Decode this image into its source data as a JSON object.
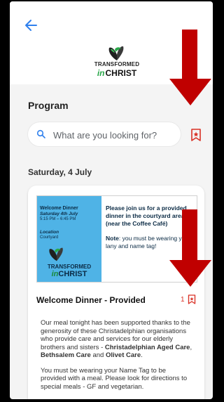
{
  "header": {
    "logo": {
      "line1": "TRANSFORMED",
      "line2_in": "in",
      "line2_rest": "CHRIST"
    }
  },
  "program": {
    "title": "Program"
  },
  "search": {
    "placeholder": "What are you looking for?"
  },
  "schedule": {
    "day_label": "Saturday, 4 July"
  },
  "event": {
    "banner": {
      "title": "Welcome Dinner",
      "date": "Saturday 4th July",
      "time": "5:15 PM – 6:45 PM",
      "location_label": "Location",
      "location": "Courtyard",
      "message": "Please join us for a provided dinner in the courtyard area (near the Coffee Café)",
      "note_label": "Note",
      "note_text": ": you must be wearing your lany and name tag!",
      "logo": {
        "line1": "TRANSFORMED",
        "line2_in": "in",
        "line2_rest": "CHRIST"
      }
    },
    "title": "Welcome Dinner - Provided",
    "bookmark_count": "1",
    "description": {
      "p1_start": "Our meal tonight has been supported thanks to the generosity of these Christadelphian organisations who provide care and services for our elderly brothers and sisters -",
      "org1": "Christadelphian Aged Care",
      "sep1": ",",
      "org2": "Bethsalem Care",
      "and": "and",
      "org3": "Olivet Care",
      "end": ".",
      "p2": "You must be wearing your Name Tag to be provided with a meal. Please look for directions to special meals - GF and vegetarian."
    }
  },
  "colors": {
    "accent": "#d93025",
    "back_arrow": "#2f80ed",
    "banner_blue": "#4fb3e6",
    "annotation_arrow": "#c00000"
  }
}
